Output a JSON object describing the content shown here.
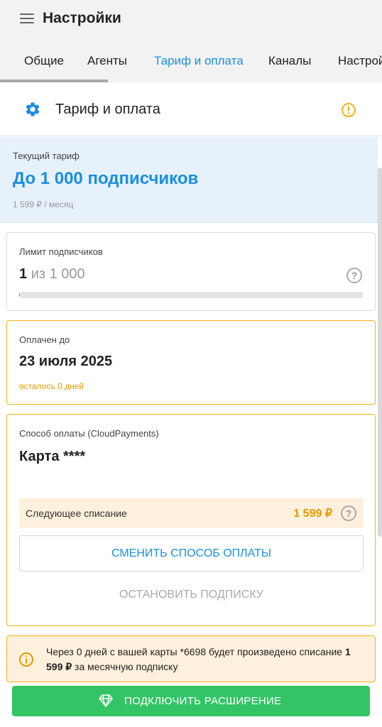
{
  "header": {
    "title": "Настройки"
  },
  "tabs": [
    {
      "label": "Общие"
    },
    {
      "label": "Агенты"
    },
    {
      "label": "Тариф и оплата"
    },
    {
      "label": "Каналы"
    },
    {
      "label": "Настрой"
    }
  ],
  "section": {
    "title": "Тариф и оплата"
  },
  "plan": {
    "label": "Текущий тариф",
    "name": "До 1 000 подписчиков",
    "price": "1 599 ₽ /  месяц"
  },
  "limit": {
    "label": "Лимит подписчиков",
    "current": "1",
    "max": "из 1 000",
    "progress_fraction": 0.001
  },
  "paid": {
    "label": "Оплачен до",
    "date": "23 июля 2025",
    "remaining": "осталось 0 дней"
  },
  "payment": {
    "label": "Способ оплаты (CloudPayments)",
    "method": "Карта ****",
    "next_label": "Следующее списание",
    "next_amount": "1 599 ₽",
    "change_button": "СМЕНИТЬ СПОСОБ ОПЛАТЫ",
    "stop_button": "ОСТАНОВИТЬ ПОДПИСКУ"
  },
  "notice": {
    "text_before": "Через 0 дней с вашей карты *6698 будет произведено списание ",
    "amount": "1 599 ₽",
    "text_after": " за месячную подписку"
  },
  "bottom_button": {
    "label": "ПОДКЛЮЧИТЬ РАСШИРЕНИЕ"
  },
  "colors": {
    "accent": "#1a8fe0",
    "warning": "#f2b11b",
    "success": "#33c466"
  }
}
